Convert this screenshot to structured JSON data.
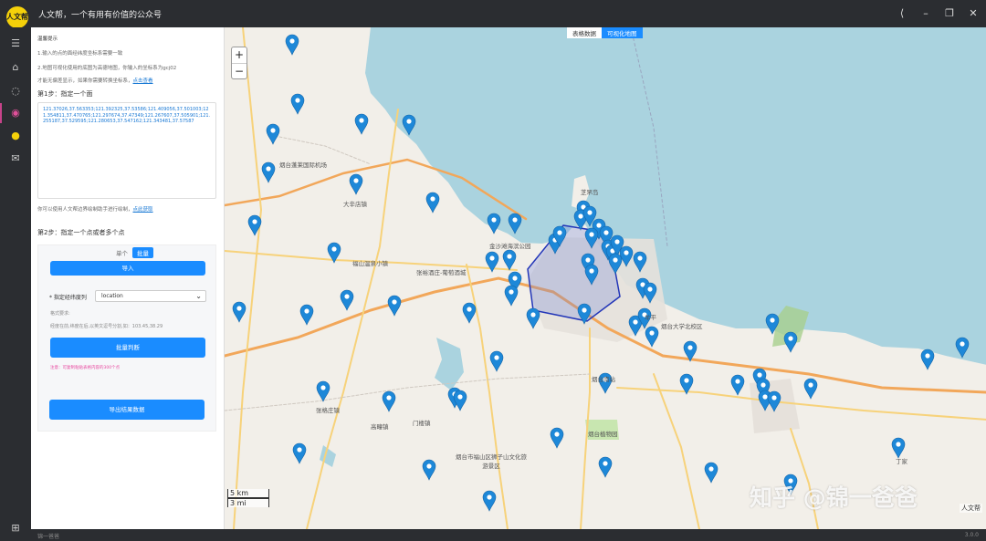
{
  "titlebar": {
    "logo_text": "人文帮",
    "title": "人文帮，一个有用有价值的公众号"
  },
  "footer": {
    "left": "锦一爸爸",
    "right": "3.0.0"
  },
  "panel": {
    "tips_title": "温馨提示",
    "tip1": "1.输入的点的面经纬度坐标系需要一致",
    "tip2": "2.地图可视化使用的底图为高德地图，你输入的坐标系为gcj02",
    "tip3_prefix": "才能无偏差显示，如果你需要转换坐标系，",
    "tip3_link": "点击查看",
    "step1": "第1步：指定一个面",
    "polygon_coords": "121.37026,37.563353;121.392325,37.53586;121.409056,37.501003;121.354811,37.470765;121.297674,37.47349;121.267607,37.505901;121.255187,37.529595;121.280653,37.547162;121.343481,37.57587",
    "hint": "你可以使用人文帮边界绘制助手进行绘制，",
    "hint_link": "点此获取",
    "step2": "第2步：指定一个点或者多个点",
    "tab_single": "单个",
    "tab_batch": "批量",
    "import_btn": "导入",
    "field_label": "* 指定经纬度列",
    "field_value": "location",
    "format_title": "格式要求:",
    "format_desc": "经度在前,纬度在后,以英文逗号分割,如：103.45,38.29",
    "judge_btn": "批量判断",
    "note": "注意：可复制粘贴表格内容的300个点",
    "export_btn": "导出结果数据"
  },
  "map": {
    "tab_table": "表格数据",
    "tab_map": "可视化地图",
    "zoom_in": "+",
    "zoom_out": "−",
    "scale_km": "5 km",
    "scale_mi": "3 mi",
    "watermark": "知乎 @锦一爸爸",
    "credit": "人文帮",
    "colors": {
      "water": "#aad3df",
      "land": "#f2efe9",
      "marker": "#1e88d8",
      "polygon": "#2336b8"
    },
    "labels": [
      "烟台蓬莱国际机场",
      "大辛店镇",
      "金沙滩海滨公园",
      "福山温泉小镇",
      "张裕酒庄-葡萄酒城",
      "烟台大学北校区",
      "烟台南站",
      "烟台植物园",
      "烟台市福山区狮子山文化旅游景区",
      "高疃镇",
      "门楼镇",
      "张格庄镇",
      "牟平",
      "芝罘岛",
      "丁家"
    ]
  }
}
